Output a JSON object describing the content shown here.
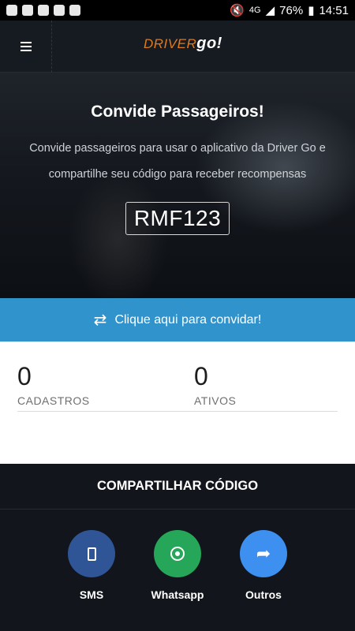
{
  "status_bar": {
    "battery": "76%",
    "time": "14:51",
    "network": "4G"
  },
  "app_bar": {
    "logo_part1": "DRIVER",
    "logo_part2": "go!"
  },
  "hero": {
    "title": "Convide Passageiros!",
    "description": "Convide passageiros para usar o aplicativo da Driver Go e compartilhe seu código para receber recompensas",
    "code": "RMF123"
  },
  "invite": {
    "label": "Clique aqui para convidar!"
  },
  "stats": [
    {
      "value": "0",
      "label": "CADASTROS"
    },
    {
      "value": "0",
      "label": "ATIVOS"
    }
  ],
  "share": {
    "title": "COMPARTILHAR CÓDIGO",
    "items": [
      {
        "label": "SMS",
        "icon": "phone-icon",
        "color": "#2f5597"
      },
      {
        "label": "Whatsapp",
        "icon": "whatsapp-icon",
        "color": "#26a659"
      },
      {
        "label": "Outros",
        "icon": "share-icon",
        "color": "#3d8ff0"
      }
    ]
  },
  "colors": {
    "accent_blue": "#3193cc",
    "logo_orange": "#e07a1c",
    "dark_bg": "#12161c"
  }
}
